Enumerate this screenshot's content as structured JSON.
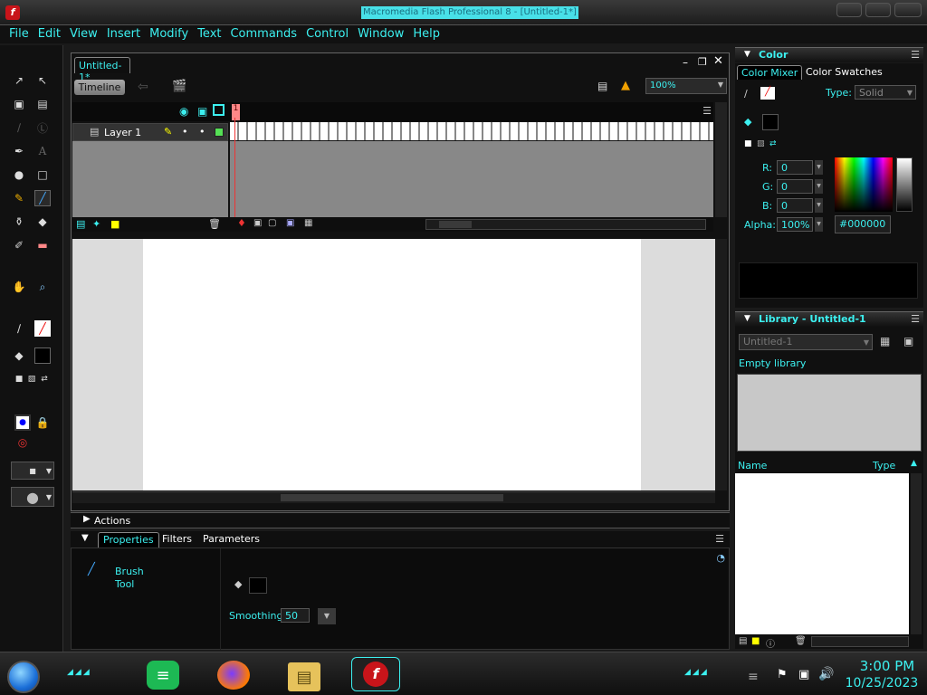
{
  "window": {
    "title": "Macromedia Flash Professional 8 - [Untitled-1*]",
    "app_icon_glyph": "f"
  },
  "menu": [
    "File",
    "Edit",
    "View",
    "Insert",
    "Modify",
    "Text",
    "Commands",
    "Control",
    "Window",
    "Help"
  ],
  "document": {
    "tab_label": "Untitled-1*",
    "timeline_button": "Timeline",
    "zoom": "100%",
    "layer_name": "Layer 1",
    "frame_marker": "1"
  },
  "actions_panel": {
    "label": "Actions"
  },
  "properties_panel": {
    "tabs": [
      "Properties",
      "Filters",
      "Parameters"
    ],
    "tool_name_line1": "Brush",
    "tool_name_line2": "Tool",
    "smoothing_label": "Smoothing",
    "smoothing_value": "50"
  },
  "color_panel": {
    "title": "Color",
    "tabs": [
      "Color Mixer",
      "Color Swatches"
    ],
    "type_label": "Type:",
    "type_value": "Solid",
    "r_label": "R:",
    "r_value": "0",
    "g_label": "G:",
    "g_value": "0",
    "b_label": "B:",
    "b_value": "0",
    "alpha_label": "Alpha:",
    "alpha_value": "100%",
    "hex_value": "#000000"
  },
  "library_panel": {
    "title": "Library - Untitled-1",
    "doc_select": "Untitled-1",
    "empty_text": "Empty library",
    "col_name": "Name",
    "col_type": "Type"
  },
  "taskbar": {
    "time": "3:00 PM",
    "date": "10/25/2023"
  },
  "colors": {
    "accent": "#3cf0f0",
    "stage": "#ffffff",
    "pasteboard": "#dcdcdc",
    "playhead": "#ee3333"
  }
}
